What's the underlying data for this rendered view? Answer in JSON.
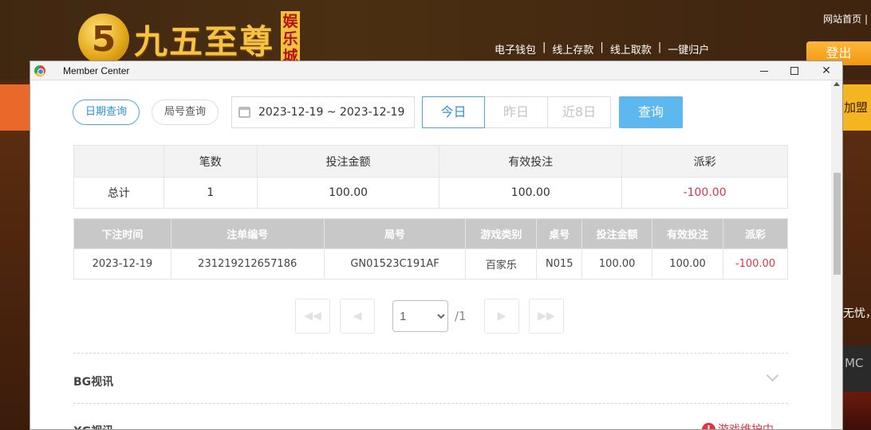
{
  "site": {
    "logo_numeral": "5",
    "logo_text": "九五至尊",
    "logo_tag": "娱乐城",
    "top_link": "网站首页 |",
    "nav": [
      "电子钱包",
      "线上存款",
      "线上取款",
      "一键归户"
    ],
    "logout": "登出",
    "join_text": "加盟",
    "side_text": "无忧，",
    "side_dark_text": "MC"
  },
  "window": {
    "title": "Member Center",
    "close_glyph": "✕"
  },
  "query": {
    "tab_date": "日期查询",
    "tab_round": "局号查询",
    "date_range": "2023-12-19 ~ 2023-12-19",
    "seg_today": "今日",
    "seg_yesterday": "昨日",
    "seg_8days": "近8日",
    "query_button": "查询"
  },
  "summary": {
    "headers": [
      "",
      "笔数",
      "投注金额",
      "有效投注",
      "派彩"
    ],
    "row": [
      "总计",
      "1",
      "100.00",
      "100.00",
      "-100.00"
    ]
  },
  "details": {
    "headers": [
      "下注时间",
      "注单编号",
      "局号",
      "游戏类别",
      "桌号",
      "投注金额",
      "有效投注",
      "派彩"
    ],
    "rows": [
      [
        "2023-12-19",
        "231219212657186",
        "GN01523C191AF",
        "百家乐",
        "N015",
        "100.00",
        "100.00",
        "-100.00"
      ]
    ]
  },
  "pager": {
    "first": "◀◀",
    "prev": "◀",
    "next": "▶",
    "last": "▶▶",
    "current": "1",
    "total": "/1"
  },
  "sections": [
    {
      "title": "BG视讯"
    },
    {
      "title": "XG视讯",
      "status": "游戏维护中",
      "status_icon": "!"
    }
  ]
}
